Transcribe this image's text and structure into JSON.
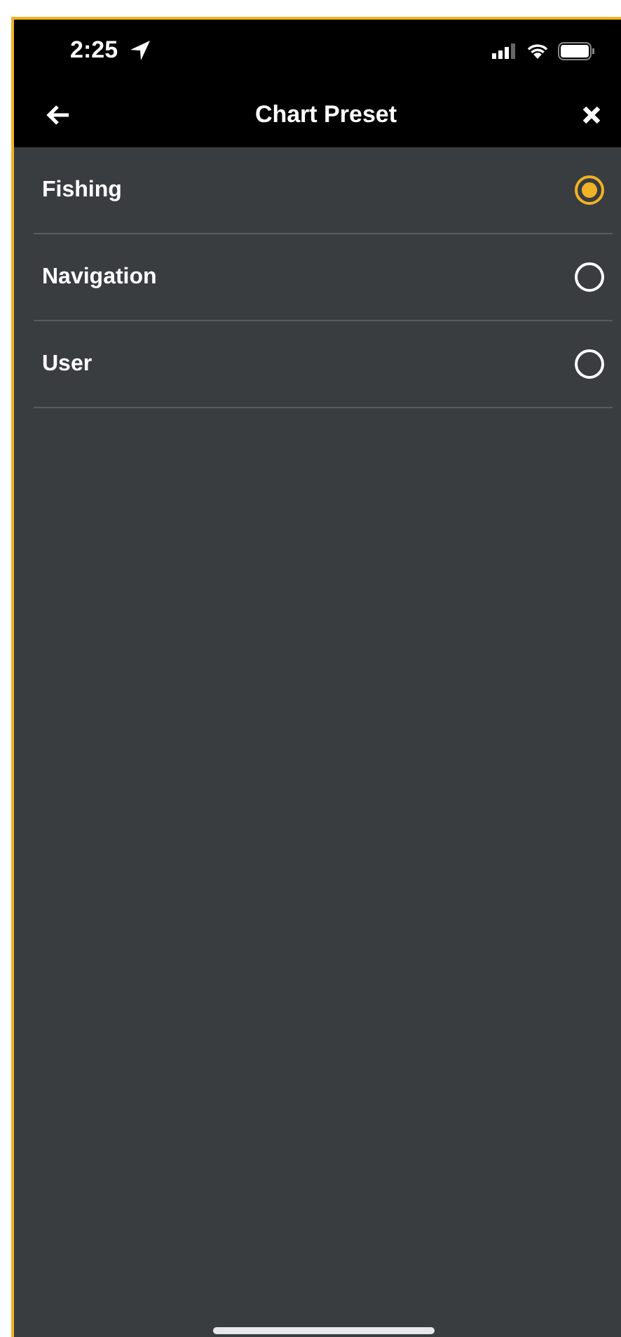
{
  "status_bar": {
    "time": "2:25"
  },
  "header": {
    "title": "Chart Preset"
  },
  "options": [
    {
      "label": "Fishing",
      "selected": true
    },
    {
      "label": "Navigation",
      "selected": false
    },
    {
      "label": "User",
      "selected": false
    }
  ]
}
